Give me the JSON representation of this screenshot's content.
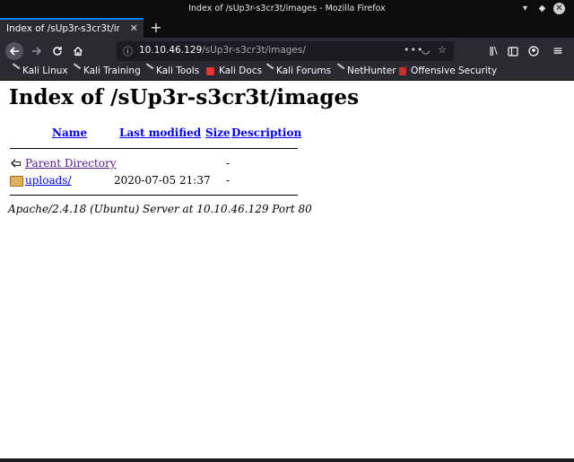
{
  "window": {
    "title": "Index of /sUp3r-s3cr3t/images - Mozilla Firefox"
  },
  "tab": {
    "label": "Index of /sUp3r-s3cr3t/images"
  },
  "urlbar": {
    "host": "10.10.46.129",
    "path": "/sUp3r-s3cr3t/images/"
  },
  "bookmarks": [
    "Kali Linux",
    "Kali Training",
    "Kali Tools",
    "Kali Docs",
    "Kali Forums",
    "NetHunter",
    "Offensive Security"
  ],
  "page": {
    "heading": "Index of /sUp3r-s3cr3t/images",
    "columns": [
      "Name",
      "Last modified",
      "Size",
      "Description"
    ],
    "rows": [
      {
        "name": "Parent Directory",
        "modified": "",
        "size": "-",
        "icon": "back-arrow-icon"
      },
      {
        "name": "uploads/",
        "modified": "2020-07-05 21:37",
        "size": "-",
        "icon": "folder-icon"
      }
    ],
    "footer": "Apache/2.4.18 (Ubuntu) Server at 10.10.46.129 Port 80"
  }
}
